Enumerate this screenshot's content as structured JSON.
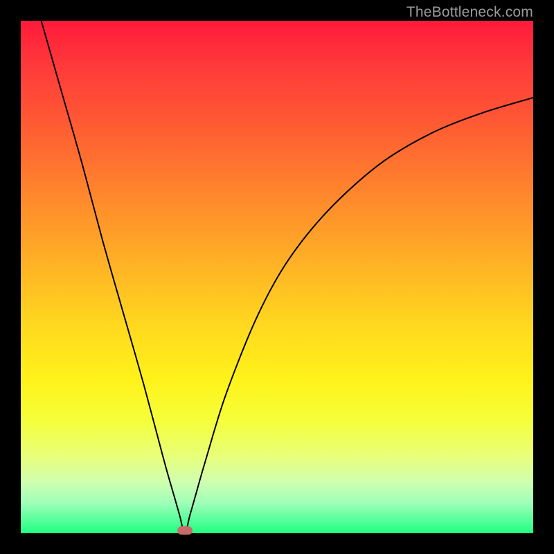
{
  "watermark": "TheBottleneck.com",
  "colors": {
    "frame": "#000000",
    "curve": "#000000",
    "marker": "#c96b6b",
    "gradient_top": "#ff1a3a",
    "gradient_bottom": "#20ff80"
  },
  "chart_data": {
    "type": "line",
    "title": "",
    "xlabel": "",
    "ylabel": "",
    "xlim": [
      0,
      100
    ],
    "ylim": [
      0,
      100
    ],
    "grid": false,
    "legend": false,
    "vertex_x": 32,
    "vertex_y": 0,
    "series": [
      {
        "name": "curve",
        "x": [
          4,
          8,
          12,
          16,
          20,
          24,
          28,
          30,
          31,
          32,
          33,
          34,
          36,
          40,
          46,
          52,
          60,
          70,
          80,
          90,
          100
        ],
        "y": [
          100,
          86,
          72,
          57,
          43,
          29,
          14,
          7,
          3.5,
          0,
          3.5,
          7,
          14,
          27,
          42,
          53,
          63,
          72,
          78,
          82,
          85
        ]
      }
    ],
    "marker": {
      "x": 32,
      "y": 0.5,
      "shape": "rounded-rect"
    },
    "axes_visible": false,
    "background": "vertical-gradient"
  }
}
